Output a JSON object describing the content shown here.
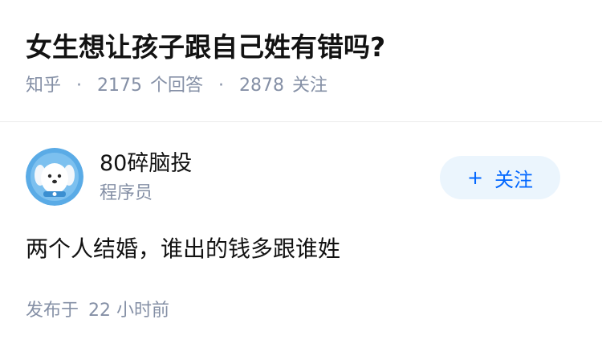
{
  "question": {
    "title": "女生想让孩子跟自己姓有错吗?",
    "source": "知乎",
    "answers_count": "2175",
    "answers_label": "个回答",
    "followers_count": "2878",
    "followers_label": "关注",
    "separator": "·"
  },
  "author": {
    "name": "80碎脑投",
    "role": "程序员",
    "avatar_icon": "cartoon-dog-avatar-icon",
    "follow_plus": "+",
    "follow_label": "关注"
  },
  "answer": {
    "content": "两个人结婚，谁出的钱多跟谁姓",
    "publish_label": "发布于",
    "publish_time": "22 小时前"
  },
  "colors": {
    "title": "#121212",
    "meta": "#8590a6",
    "accent": "#0066ff",
    "follow_bg": "#ebf5fd",
    "avatar_bg": "#5aabe6"
  }
}
